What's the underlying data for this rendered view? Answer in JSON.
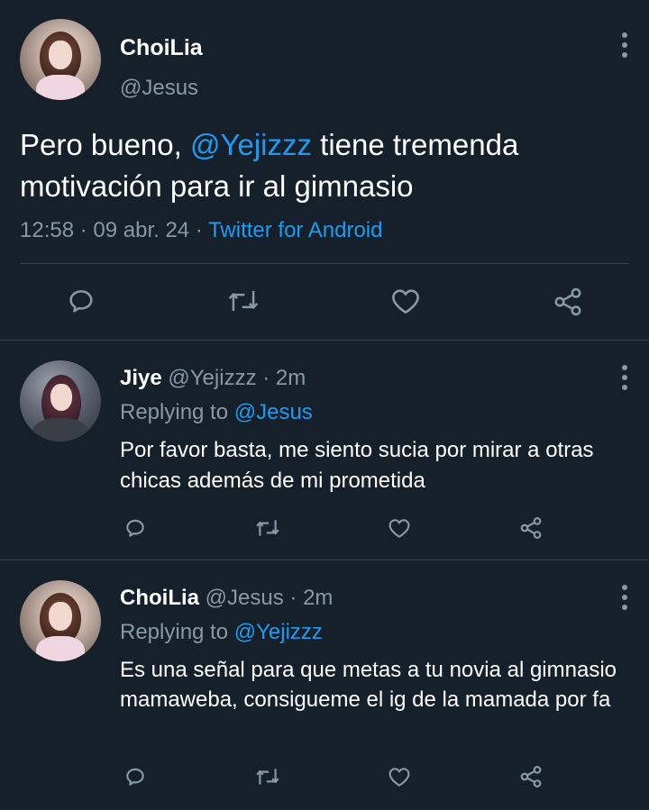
{
  "main_tweet": {
    "display_name": "ChoiLia",
    "handle": "@Jesus",
    "text_before": "Pero bueno, ",
    "mention": "@Yejizzz",
    "text_after": " tiene tremenda motivación para ir al gimnasio",
    "time": "12:58",
    "sep1": " · ",
    "date": "09 abr. 24",
    "sep2": " · ",
    "source": "Twitter for Android"
  },
  "replies": [
    {
      "display_name": "Jiye",
      "handle": "@Yejizzz",
      "dot": " · ",
      "time_ago": "2m",
      "replying_label": "Replying to ",
      "replying_to": "@Jesus",
      "text": "Por favor basta, me siento sucia por mirar a otras chicas además de mi prometida"
    },
    {
      "display_name": "ChoiLia",
      "handle": "@Jesus",
      "dot": " · ",
      "time_ago": "2m",
      "replying_label": "Replying to ",
      "replying_to": "@Yejizzz",
      "text": "Es una señal para que metas a tu novia al gimnasio mamaweba, consigueme el ig de la mamada por fa"
    }
  ],
  "icons": {
    "reply": "reply-icon",
    "retweet": "retweet-icon",
    "like": "like-icon",
    "share": "share-icon",
    "more": "more-icon"
  },
  "colors": {
    "background": "#15202b",
    "text": "#ffffff",
    "muted": "#8899a6",
    "accent": "#1d9bf0",
    "divider": "#38444d"
  }
}
